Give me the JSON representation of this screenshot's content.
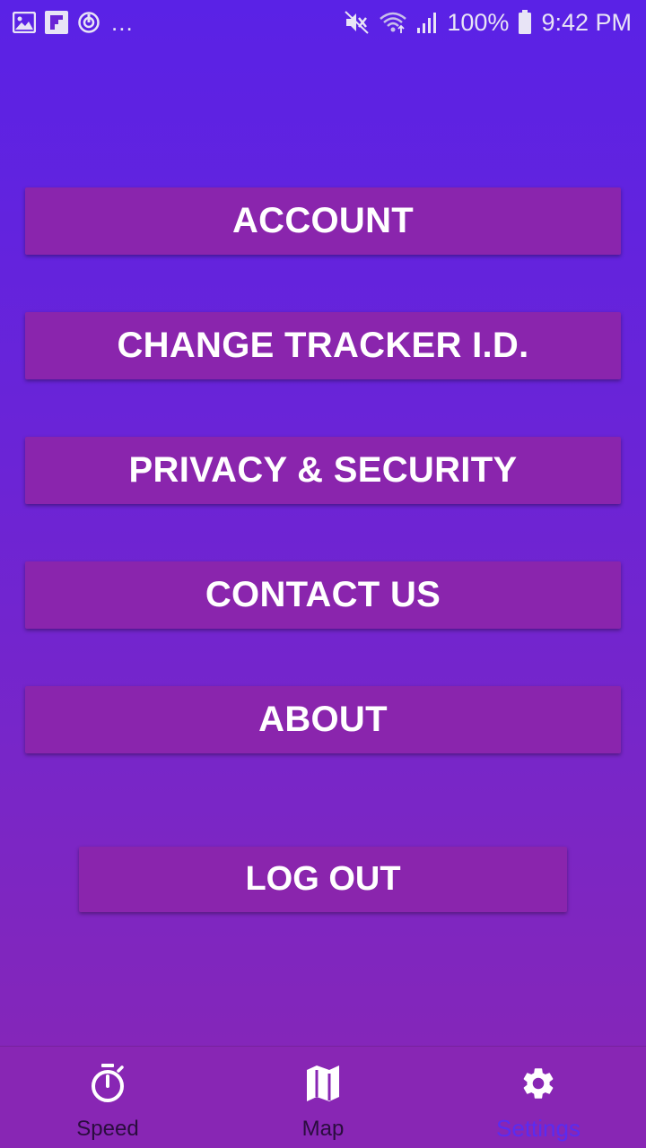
{
  "status_bar": {
    "left_icons": [
      "gallery-icon",
      "flipboard-icon",
      "sync-icon"
    ],
    "overflow": "...",
    "right_icons": [
      "mute-icon",
      "wifi-icon",
      "signal-icon",
      "battery-icon"
    ],
    "battery": "100%",
    "time": "9:42 PM"
  },
  "menu": {
    "account": "ACCOUNT",
    "change_tracker": "CHANGE TRACKER I.D.",
    "privacy": "PRIVACY & SECURITY",
    "contact": "CONTACT US",
    "about": "ABOUT",
    "logout": "LOG OUT"
  },
  "bottom_nav": {
    "items": [
      {
        "label": "Speed",
        "icon": "stopwatch-icon"
      },
      {
        "label": "Map",
        "icon": "map-icon"
      },
      {
        "label": "Settings",
        "icon": "gear-icon",
        "active": true
      }
    ]
  },
  "colors": {
    "background_top": "#5a22e6",
    "background_bottom": "#8826b4",
    "button": "#8a25ad",
    "active_nav": "#5a2cf0"
  }
}
